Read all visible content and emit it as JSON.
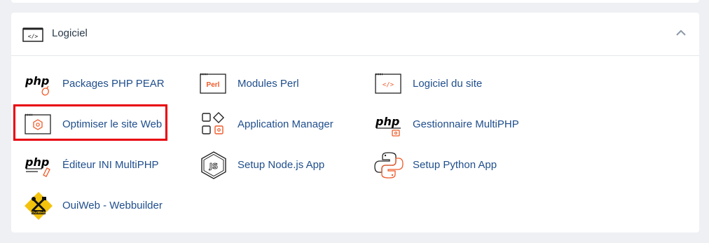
{
  "section": {
    "title": "Logiciel",
    "icon": "code-window-icon",
    "collapse_icon": "chevron-up-icon"
  },
  "items": [
    {
      "label": "Packages PHP PEAR",
      "icon": "php-pear-icon"
    },
    {
      "label": "Modules Perl",
      "icon": "perl-icon"
    },
    {
      "label": "Logiciel du site",
      "icon": "code-window-icon"
    },
    {
      "label": "Optimiser le site Web",
      "icon": "optimize-website-icon"
    },
    {
      "label": "Application Manager",
      "icon": "application-manager-icon"
    },
    {
      "label": "Gestionnaire MultiPHP",
      "icon": "multiphp-manager-icon"
    },
    {
      "label": "Éditeur INI MultiPHP",
      "icon": "multiphp-ini-editor-icon"
    },
    {
      "label": "Setup Node.js App",
      "icon": "nodejs-icon"
    },
    {
      "label": "Setup Python App",
      "icon": "python-icon"
    },
    {
      "label": "OuiWeb - Webbuilder",
      "icon": "ouiweb-logo-icon"
    }
  ],
  "logos": {
    "perl_text": "Perl",
    "php_text": "php",
    "ouiweb_text": "OuiWeb"
  },
  "colors": {
    "link": "#1f4e8c",
    "accent": "#f05a28",
    "highlight": "#e8000b",
    "ouiweb_yellow": "#f4c20d"
  }
}
